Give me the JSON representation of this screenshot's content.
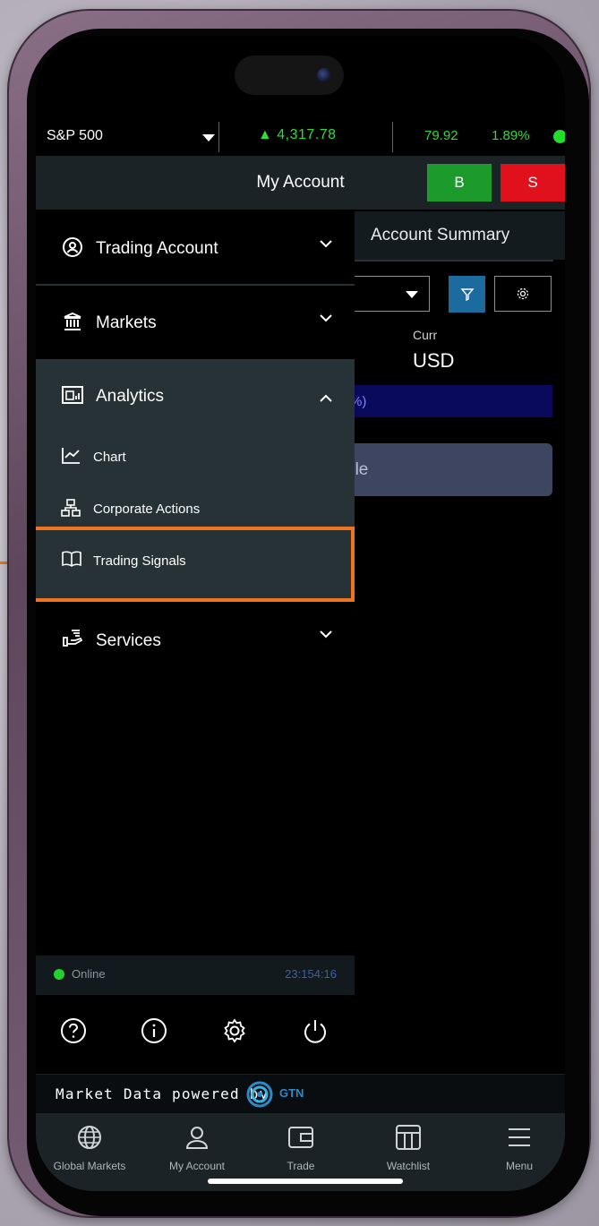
{
  "ticker": {
    "index_name": "S&P 500",
    "price": "4,317.78",
    "change": "79.92",
    "change_pct": "1.89%",
    "up_arrow": "🡑",
    "status_color": "#22dd2a"
  },
  "header": {
    "title": "My Account",
    "buy_label": "B",
    "sell_label": "S"
  },
  "background": {
    "summary_tab": "Account Summary",
    "curr_label": "Curr",
    "curr_value": "USD",
    "blue_bar_text": ")%)",
    "grey_card_text": "ole"
  },
  "drawer": {
    "items": [
      {
        "label": "Trading Account",
        "icon": "user-circle-icon",
        "expanded": false
      },
      {
        "label": "Markets",
        "icon": "bank-icon",
        "expanded": false
      },
      {
        "label": "Analytics",
        "icon": "analytics-icon",
        "expanded": true
      },
      {
        "label": "Services",
        "icon": "services-icon",
        "expanded": false
      }
    ],
    "analytics_children": [
      {
        "label": "Chart",
        "icon": "line-chart-icon"
      },
      {
        "label": "Corporate Actions",
        "icon": "org-chart-icon"
      },
      {
        "label": "Trading Signals",
        "icon": "book-open-icon",
        "highlighted": true
      }
    ],
    "status": {
      "label": "Online",
      "time": "23:154:16"
    },
    "highlight_color": "#f0731e"
  },
  "utilities": [
    "help-icon",
    "info-icon",
    "settings-icon",
    "power-icon"
  ],
  "footer": {
    "powered_text": "Market Data powered by",
    "brand": "GTN"
  },
  "nav": [
    {
      "label": "Global Markets",
      "icon": "globe-icon"
    },
    {
      "label": "My Account",
      "icon": "user-icon"
    },
    {
      "label": "Trade",
      "icon": "wallet-icon"
    },
    {
      "label": "Watchlist",
      "icon": "watchlist-icon"
    },
    {
      "label": "Menu",
      "icon": "menu-icon"
    }
  ]
}
